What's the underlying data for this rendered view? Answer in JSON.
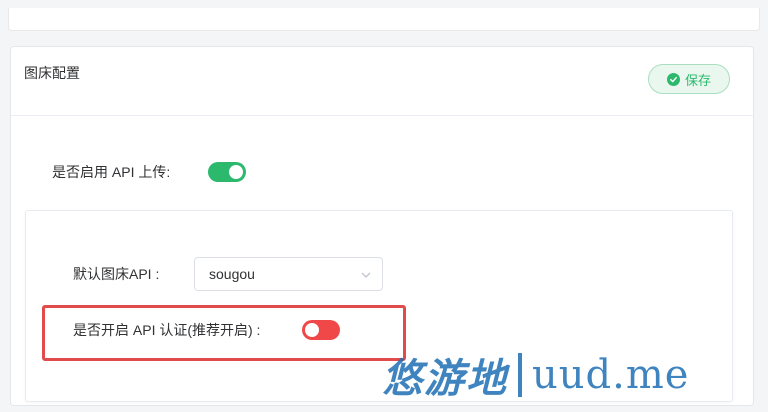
{
  "card": {
    "title": "图床配置",
    "save_label": "保存"
  },
  "settings": {
    "enable_api_upload_label": "是否启用 API 上传:",
    "enable_api_upload_state": "on",
    "default_api_label": "默认图床API :",
    "default_api_value": "sougou",
    "api_auth_label": "是否开启 API 认证(推荐开启) :",
    "api_auth_state": "off"
  },
  "watermark": {
    "cn": "悠游地",
    "en": "uud.me"
  },
  "colors": {
    "switch_on": "#2db96d",
    "switch_off": "#f04848",
    "highlight": "#e24b4b",
    "watermark": "#1f6fb5"
  }
}
